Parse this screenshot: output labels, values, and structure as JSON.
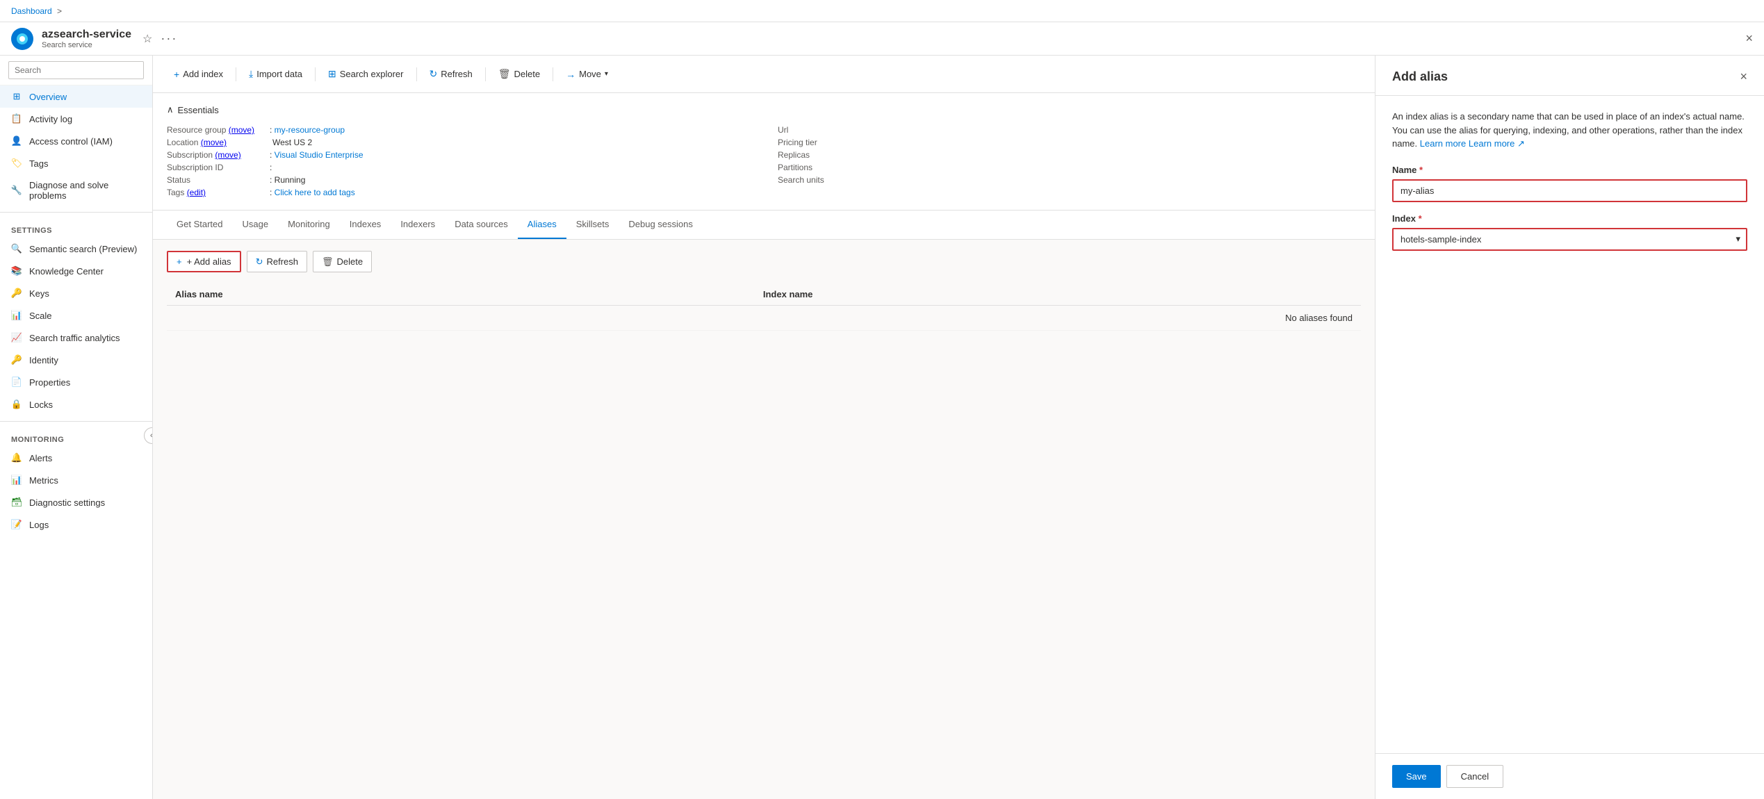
{
  "topbar": {
    "service_name": "azsearch-service",
    "service_type": "Search service",
    "close_label": "×",
    "favorite_icon": "★",
    "more_icon": "···"
  },
  "breadcrumb": {
    "items": [
      "Dashboard",
      ">"
    ]
  },
  "sidebar": {
    "search_placeholder": "Search",
    "items": [
      {
        "id": "overview",
        "label": "Overview",
        "active": true
      },
      {
        "id": "activity-log",
        "label": "Activity log"
      },
      {
        "id": "access-control",
        "label": "Access control (IAM)"
      },
      {
        "id": "tags",
        "label": "Tags"
      },
      {
        "id": "diagnose",
        "label": "Diagnose and solve problems"
      }
    ],
    "settings_label": "Settings",
    "settings_items": [
      {
        "id": "semantic-search",
        "label": "Semantic search (Preview)"
      },
      {
        "id": "knowledge-center",
        "label": "Knowledge Center"
      },
      {
        "id": "keys",
        "label": "Keys"
      },
      {
        "id": "scale",
        "label": "Scale"
      },
      {
        "id": "search-traffic",
        "label": "Search traffic analytics"
      },
      {
        "id": "identity",
        "label": "Identity"
      },
      {
        "id": "properties",
        "label": "Properties"
      },
      {
        "id": "locks",
        "label": "Locks"
      }
    ],
    "monitoring_label": "Monitoring",
    "monitoring_items": [
      {
        "id": "alerts",
        "label": "Alerts"
      },
      {
        "id": "metrics",
        "label": "Metrics"
      },
      {
        "id": "diagnostic-settings",
        "label": "Diagnostic settings"
      },
      {
        "id": "logs",
        "label": "Logs"
      }
    ]
  },
  "toolbar": {
    "add_index": "Add index",
    "import_data": "Import data",
    "search_explorer": "Search explorer",
    "refresh": "Refresh",
    "delete": "Delete",
    "move": "Move"
  },
  "essentials": {
    "title": "Essentials",
    "rows_left": [
      {
        "label": "Resource group (move)",
        "value": "my-resource-group",
        "link": true
      },
      {
        "label": "Location (move)",
        "value": "West US 2"
      },
      {
        "label": "Subscription (move)",
        "value": "Visual Studio Enterprise",
        "link": true
      },
      {
        "label": "Subscription ID",
        "value": ""
      },
      {
        "label": "Status",
        "value": "Running"
      },
      {
        "label": "Tags (edit)",
        "value": "Click here to add tags",
        "link": true
      }
    ],
    "rows_right": [
      {
        "label": "Url",
        "value": ""
      },
      {
        "label": "Pricing tier",
        "value": ""
      },
      {
        "label": "Replicas",
        "value": ""
      },
      {
        "label": "Partitions",
        "value": ""
      },
      {
        "label": "Search units",
        "value": ""
      }
    ]
  },
  "tabs": {
    "items": [
      {
        "id": "get-started",
        "label": "Get Started"
      },
      {
        "id": "usage",
        "label": "Usage"
      },
      {
        "id": "monitoring",
        "label": "Monitoring"
      },
      {
        "id": "indexes",
        "label": "Indexes"
      },
      {
        "id": "indexers",
        "label": "Indexers"
      },
      {
        "id": "data-sources",
        "label": "Data sources"
      },
      {
        "id": "aliases",
        "label": "Aliases",
        "active": true
      },
      {
        "id": "skillsets",
        "label": "Skillsets"
      },
      {
        "id": "debug-sessions",
        "label": "Debug sessions"
      }
    ]
  },
  "aliases_tab": {
    "add_alias_btn": "+ Add alias",
    "refresh_btn": "Refresh",
    "delete_btn": "Delete",
    "col_alias": "Alias name",
    "col_index": "Index name",
    "no_data": "No aliases found"
  },
  "add_alias_panel": {
    "title": "Add alias",
    "close_btn": "×",
    "description": "An index alias is a secondary name that can be used in place of an index's actual name. You can use the alias for querying, indexing, and other operations, rather than the index name.",
    "learn_more": "Learn more",
    "name_label": "Name",
    "name_required": "*",
    "name_value": "my-alias",
    "index_label": "Index",
    "index_required": "*",
    "index_value": "hotels-sample-index",
    "index_options": [
      "hotels-sample-index"
    ],
    "save_btn": "Save",
    "cancel_btn": "Cancel"
  }
}
